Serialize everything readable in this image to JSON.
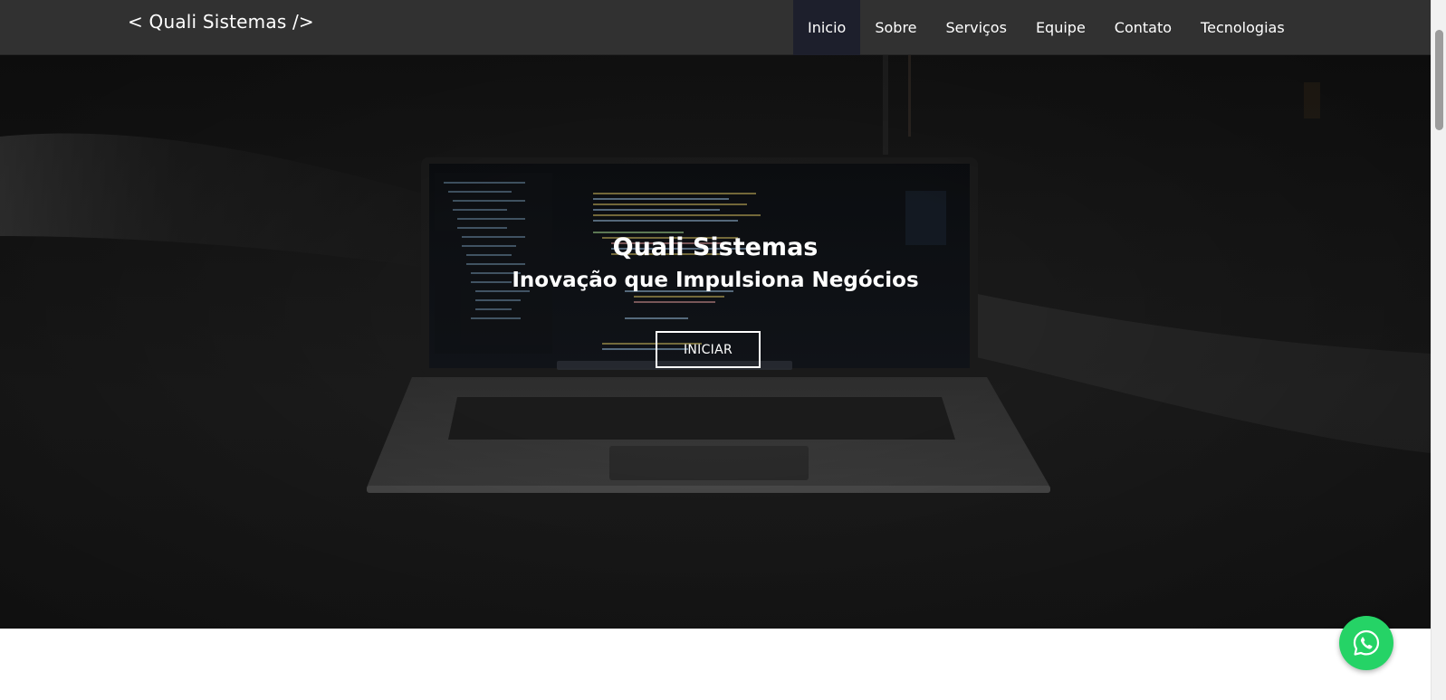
{
  "brand": {
    "label": "< Quali Sistemas />"
  },
  "nav": {
    "items": [
      {
        "label": "Inicio",
        "active": true
      },
      {
        "label": "Sobre",
        "active": false
      },
      {
        "label": "Serviços",
        "active": false
      },
      {
        "label": "Equipe",
        "active": false
      },
      {
        "label": "Contato",
        "active": false
      },
      {
        "label": "Tecnologias",
        "active": false
      }
    ]
  },
  "hero": {
    "title": "Quali Sistemas",
    "subtitle": "Inovação que Impulsiona Negócios",
    "button_label": "INICIAR"
  },
  "colors": {
    "navbar_bg": "#313131",
    "nav_active_bg": "#1d1f2c",
    "whatsapp_green": "#25d366",
    "hero_overlay": "#141414"
  },
  "icons": {
    "whatsapp": "whatsapp-icon"
  }
}
